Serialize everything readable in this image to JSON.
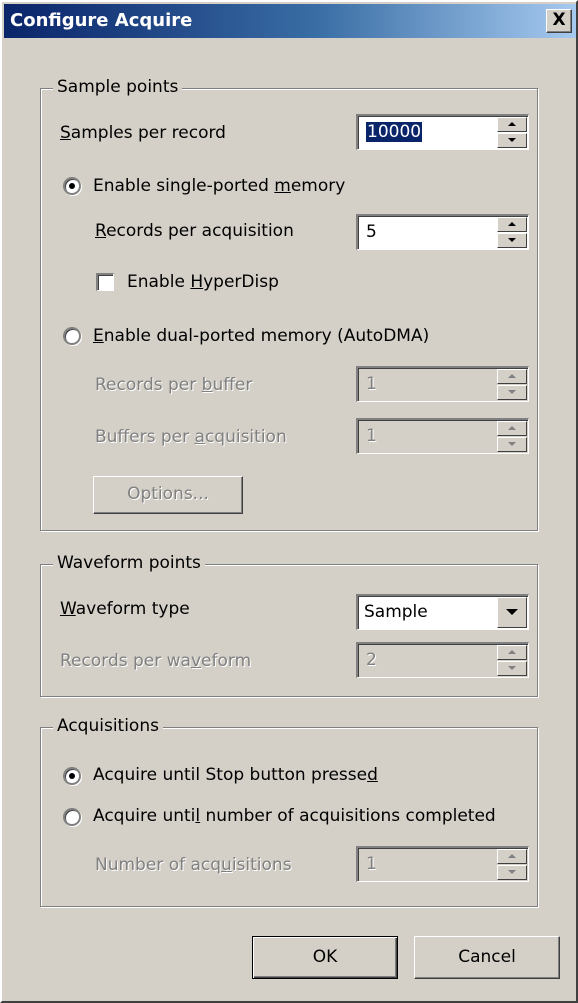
{
  "window": {
    "title": "Configure Acquire",
    "close_label": "X"
  },
  "sample_points": {
    "legend": "Sample points",
    "samples_per_record": {
      "label_pre": "",
      "label_ul": "S",
      "label_post": "amples per record",
      "value": "10000"
    },
    "single_ported": {
      "label_pre": "Enable single-ported ",
      "label_ul": "m",
      "label_post": "emory",
      "checked": true
    },
    "records_per_acq": {
      "label_pre": "",
      "label_ul": "R",
      "label_post": "ecords per acquisition",
      "value": "5"
    },
    "hyperdisp": {
      "label_pre": "Enable ",
      "label_ul": "H",
      "label_post": "yperDisp",
      "checked": false
    },
    "dual_ported": {
      "label_pre": "",
      "label_ul": "E",
      "label_post": "nable dual-ported memory (AutoDMA)",
      "checked": false
    },
    "records_per_buffer": {
      "label_pre": "Records per ",
      "label_ul": "b",
      "label_post": "uffer",
      "value": "1"
    },
    "buffers_per_acq": {
      "label_pre": "Buffers per ",
      "label_ul": "a",
      "label_post": "cquisition",
      "value": "1"
    },
    "options_label": "Options..."
  },
  "waveform_points": {
    "legend": "Waveform points",
    "waveform_type": {
      "label_pre": "",
      "label_ul": "W",
      "label_post": "aveform type",
      "value": "Sample"
    },
    "records_per_waveform": {
      "label_pre": "Records per wa",
      "label_ul": "v",
      "label_post": "eform",
      "value": "2"
    }
  },
  "acquisitions": {
    "legend": "Acquisitions",
    "until_stop": {
      "label_pre": "Acquire until Stop button presse",
      "label_ul": "d",
      "label_post": "",
      "checked": true
    },
    "until_number": {
      "label_pre": "Acquire unti",
      "label_ul": "l",
      "label_post": " number of acquisitions completed",
      "checked": false
    },
    "number": {
      "label_pre": "Number of acq",
      "label_ul": "u",
      "label_post": "isitions",
      "value": "1"
    }
  },
  "buttons": {
    "ok": "OK",
    "cancel": "Cancel"
  }
}
